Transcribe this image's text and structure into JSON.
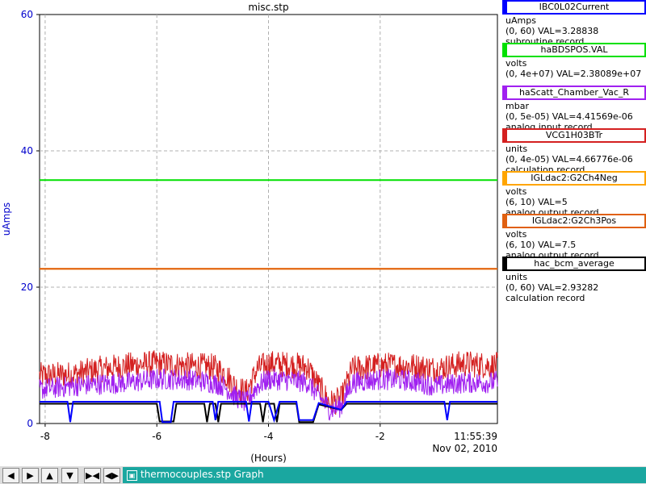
{
  "window": {
    "title": "thermocouples.stp Graph"
  },
  "chart_data": {
    "type": "line",
    "title": "misc.stp",
    "xlabel": "(Hours)",
    "ylabel": "uAmps",
    "xlim": [
      -8.1,
      0.1
    ],
    "ylim": [
      0,
      60
    ],
    "xticks": [
      -8,
      -6,
      -4,
      -2
    ],
    "xtick_labels": [
      "-8",
      "-6",
      "-4",
      "-2"
    ],
    "yticks": [
      0,
      20,
      40,
      60
    ],
    "ytick_labels": [
      "0",
      "20",
      "40",
      "60"
    ],
    "time_label": "11:55:39",
    "date_label": "Nov 02, 2010",
    "grid": true,
    "series": [
      {
        "name": "IBC0L02Current",
        "color": "#0000ff",
        "points": [
          [
            -8.1,
            3.2
          ],
          [
            -7.6,
            3.2
          ],
          [
            -7.55,
            0.2
          ],
          [
            -7.5,
            3.2
          ],
          [
            -5.95,
            3.2
          ],
          [
            -5.9,
            0.2
          ],
          [
            -5.75,
            0.2
          ],
          [
            -5.7,
            3.2
          ],
          [
            -5.0,
            3.2
          ],
          [
            -4.95,
            0.5
          ],
          [
            -4.9,
            3.2
          ],
          [
            -4.4,
            3.2
          ],
          [
            -4.35,
            0.3
          ],
          [
            -4.3,
            3.2
          ],
          [
            -4.0,
            3.2
          ],
          [
            -3.9,
            0.5
          ],
          [
            -3.8,
            3.2
          ],
          [
            -3.5,
            3.2
          ],
          [
            -3.45,
            0.5
          ],
          [
            -3.2,
            0.5
          ],
          [
            -3.1,
            3.0
          ],
          [
            -2.7,
            2.0
          ],
          [
            -2.6,
            3.2
          ],
          [
            -0.85,
            3.2
          ],
          [
            -0.8,
            0.5
          ],
          [
            -0.75,
            3.2
          ],
          [
            0.1,
            3.2
          ]
        ]
      },
      {
        "name": "haBDSPOS.VAL",
        "color": "#00e000",
        "points": [
          [
            -8.1,
            35.7
          ],
          [
            0.1,
            35.7
          ]
        ]
      },
      {
        "name": "haScatt_Chamber_Vac_R",
        "color": "#a020f0",
        "points": [
          [
            -8.1,
            5.0
          ],
          [
            -7.5,
            5.5
          ],
          [
            -7.0,
            5.8
          ],
          [
            -6.5,
            6.0
          ],
          [
            -6.0,
            6.5
          ],
          [
            -5.5,
            6.5
          ],
          [
            -5.0,
            6.0
          ],
          [
            -4.8,
            5.5
          ],
          [
            -4.6,
            4.0
          ],
          [
            -4.4,
            3.0
          ],
          [
            -4.2,
            5.5
          ],
          [
            -4.0,
            6.5
          ],
          [
            -3.6,
            6.3
          ],
          [
            -3.3,
            6.0
          ],
          [
            -3.1,
            4.0
          ],
          [
            -2.9,
            2.0
          ],
          [
            -2.7,
            2.5
          ],
          [
            -2.5,
            6.0
          ],
          [
            -2.0,
            6.5
          ],
          [
            -1.5,
            6.3
          ],
          [
            -1.0,
            5.5
          ],
          [
            -0.5,
            6.0
          ],
          [
            0.0,
            6.0
          ],
          [
            0.1,
            6.2
          ]
        ],
        "noise": 1.6
      },
      {
        "name": "VCG1H03BTr",
        "color": "#d42020",
        "points": [
          [
            -8.1,
            7.0
          ],
          [
            -7.5,
            7.2
          ],
          [
            -7.0,
            8.0
          ],
          [
            -6.5,
            8.5
          ],
          [
            -6.0,
            8.8
          ],
          [
            -5.5,
            8.5
          ],
          [
            -5.0,
            8.3
          ],
          [
            -4.8,
            7.5
          ],
          [
            -4.6,
            5.5
          ],
          [
            -4.4,
            4.5
          ],
          [
            -4.2,
            8.0
          ],
          [
            -4.0,
            8.8
          ],
          [
            -3.6,
            8.6
          ],
          [
            -3.3,
            8.3
          ],
          [
            -3.1,
            5.5
          ],
          [
            -2.9,
            3.0
          ],
          [
            -2.7,
            3.5
          ],
          [
            -2.5,
            8.0
          ],
          [
            -2.0,
            8.5
          ],
          [
            -1.5,
            8.5
          ],
          [
            -1.0,
            8.0
          ],
          [
            -0.5,
            8.8
          ],
          [
            0.0,
            8.5
          ],
          [
            0.1,
            8.5
          ]
        ],
        "noise": 2.0
      },
      {
        "name": "IGLdac2:G2Ch4Neg",
        "color": "#ffa500",
        "points": [
          [
            -8.1,
            22.7
          ],
          [
            0.1,
            22.7
          ]
        ]
      },
      {
        "name": "IGLdac2:G2Ch3Pos",
        "color": "#e06010",
        "points": [
          [
            -8.1,
            22.7
          ],
          [
            0.1,
            22.7
          ]
        ]
      },
      {
        "name": "hac_bcm_average",
        "color": "#000000",
        "points": [
          [
            -8.1,
            2.9
          ],
          [
            -6.0,
            2.9
          ],
          [
            -5.95,
            0.3
          ],
          [
            -5.7,
            0.3
          ],
          [
            -5.65,
            2.9
          ],
          [
            -5.15,
            2.9
          ],
          [
            -5.1,
            0.2
          ],
          [
            -5.05,
            2.9
          ],
          [
            -4.95,
            2.9
          ],
          [
            -4.9,
            0.2
          ],
          [
            -4.85,
            2.9
          ],
          [
            -4.15,
            2.9
          ],
          [
            -4.1,
            0.2
          ],
          [
            -4.05,
            2.9
          ],
          [
            -3.9,
            2.9
          ],
          [
            -3.85,
            0.2
          ],
          [
            -3.8,
            2.9
          ],
          [
            -3.5,
            2.9
          ],
          [
            -3.45,
            0.2
          ],
          [
            -3.2,
            0.2
          ],
          [
            -3.1,
            2.8
          ],
          [
            -2.7,
            2.0
          ],
          [
            -2.6,
            2.9
          ],
          [
            0.1,
            2.9
          ]
        ]
      }
    ]
  },
  "legend": [
    {
      "name": "IBC0L02Current",
      "color": "#0000ff",
      "units": "uAmps",
      "range": "(0, 60) VAL=3.28838",
      "rtype": "subroutine record"
    },
    {
      "name": "haBDSPOS.VAL",
      "color": "#00e000",
      "units": "volts",
      "range": "(0, 4e+07) VAL=2.38089e+07",
      "rtype": ""
    },
    {
      "name": "haScatt_Chamber_Vac_R",
      "color": "#a020f0",
      "units": "mbar",
      "range": "(0, 5e-05) VAL=4.41569e-06",
      "rtype": "analog input record"
    },
    {
      "name": "VCG1H03BTr",
      "color": "#d42020",
      "units": "units",
      "range": "(0, 4e-05) VAL=4.66776e-06",
      "rtype": "calculation record"
    },
    {
      "name": "IGLdac2:G2Ch4Neg",
      "color": "#ffa500",
      "units": "volts",
      "range": "(6, 10) VAL=5",
      "rtype": "analog output record"
    },
    {
      "name": "IGLdac2:G2Ch3Pos",
      "color": "#e06010",
      "units": "volts",
      "range": "(6, 10) VAL=7.5",
      "rtype": "analog output record"
    },
    {
      "name": "hac_bcm_average",
      "color": "#000000",
      "units": "units",
      "range": "(0, 60) VAL=2.93282",
      "rtype": "calculation record"
    }
  ],
  "toolbar": {
    "buttons": [
      {
        "name": "scroll-left-button",
        "glyph": "◀"
      },
      {
        "name": "scroll-right-button",
        "glyph": "▶"
      },
      {
        "name": "scroll-up-button",
        "glyph": "▲"
      },
      {
        "name": "scroll-down-button",
        "glyph": "▼"
      },
      {
        "name": "zoom-in-x-button",
        "glyph": "▶◀"
      },
      {
        "name": "zoom-out-x-button",
        "glyph": "◀▶"
      }
    ]
  },
  "task_tab": {
    "icon": "window-icon"
  }
}
